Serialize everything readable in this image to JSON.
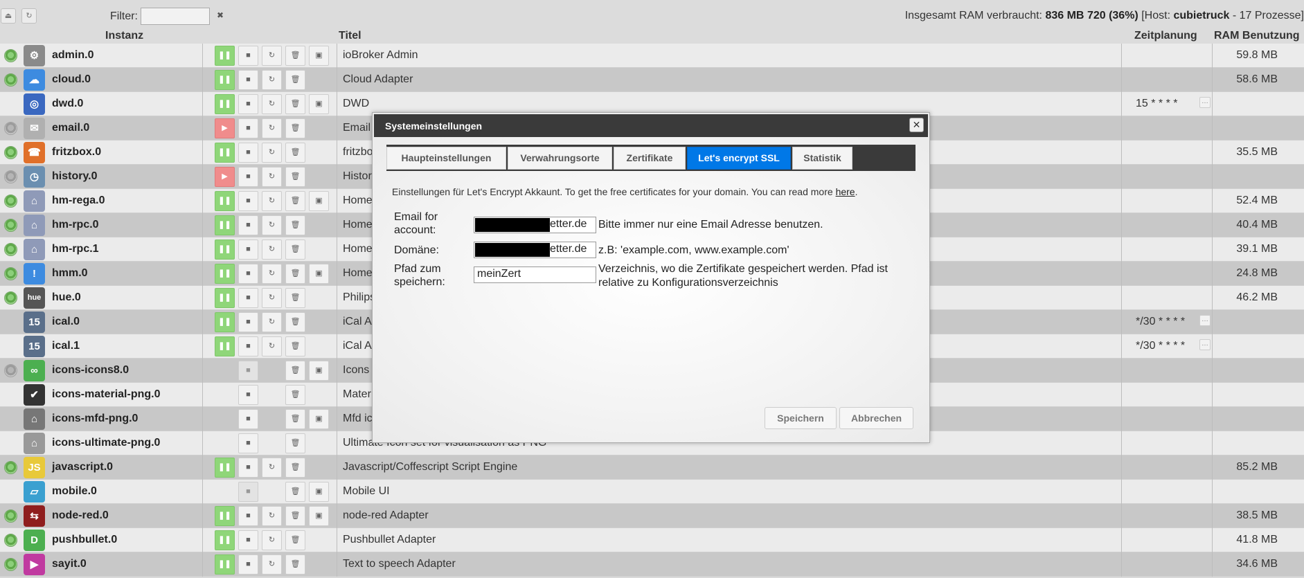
{
  "toolbar": {
    "filter_label": "Filter:",
    "filter_value": "",
    "ram_prefix": "Insgesamt RAM verbraucht:",
    "ram_total": "836",
    "ram_unit": "MB",
    "ram_free": "720 (36%)",
    "host_prefix": "[Host:",
    "host_name": "cubietruck",
    "host_suffix": "- 17 Prozesse]"
  },
  "columns": {
    "instanz": "Instanz",
    "titel": "Titel",
    "zeitplanung": "Zeitplanung",
    "ram": "RAM Benutzung"
  },
  "rows": [
    {
      "name": "admin.0",
      "title": "ioBroker Admin",
      "sched": "",
      "ram": "59.8 MB",
      "status": "on",
      "icon": "gear-icon",
      "glyph": "⚙",
      "color": "#8a8a8a",
      "run": "pause",
      "img": true,
      "restart": true
    },
    {
      "name": "cloud.0",
      "title": "Cloud Adapter",
      "sched": "",
      "ram": "58.6 MB",
      "status": "on",
      "icon": "cloud-icon",
      "glyph": "☁",
      "color": "#3d8be0",
      "run": "pause",
      "img": false,
      "restart": true
    },
    {
      "name": "dwd.0",
      "title": "DWD",
      "sched": "15 * * * *",
      "ram": "",
      "status": "none",
      "icon": "weather-spiral-icon",
      "glyph": "◎",
      "color": "#3a68c0",
      "run": "pause",
      "img": true,
      "restart": true
    },
    {
      "name": "email.0",
      "title": "Email",
      "sched": "",
      "ram": "",
      "status": "off",
      "icon": "envelope-icon",
      "glyph": "✉",
      "color": "#b0b0b0",
      "run": "play",
      "img": false,
      "restart": true
    },
    {
      "name": "fritzbox.0",
      "title": "fritzbox",
      "sched": "",
      "ram": "35.5 MB",
      "status": "on",
      "icon": "phone-icon",
      "glyph": "☎",
      "color": "#e0702a",
      "run": "pause",
      "img": false,
      "restart": true
    },
    {
      "name": "history.0",
      "title": "History",
      "sched": "",
      "ram": "",
      "status": "off",
      "icon": "clock-icon",
      "glyph": "◷",
      "color": "#6b8fb0",
      "run": "play",
      "img": false,
      "restart": true
    },
    {
      "name": "hm-rega.0",
      "title": "Homematic",
      "sched": "",
      "ram": "52.4 MB",
      "status": "on",
      "icon": "homematic-icon",
      "glyph": "⌂",
      "color": "#8f9ab8",
      "run": "pause",
      "img": true,
      "restart": true
    },
    {
      "name": "hm-rpc.0",
      "title": "Homematic",
      "sched": "",
      "ram": "40.4 MB",
      "status": "on",
      "icon": "homematic-icon",
      "glyph": "⌂",
      "color": "#8f9ab8",
      "run": "pause",
      "img": false,
      "restart": true
    },
    {
      "name": "hm-rpc.1",
      "title": "Homematic",
      "sched": "",
      "ram": "39.1 MB",
      "status": "on",
      "icon": "homematic-icon",
      "glyph": "⌂",
      "color": "#8f9ab8",
      "run": "pause",
      "img": false,
      "restart": true
    },
    {
      "name": "hmm.0",
      "title": "Homematic",
      "sched": "",
      "ram": "24.8 MB",
      "status": "on",
      "icon": "exclamation-icon",
      "glyph": "!",
      "color": "#3d8be0",
      "run": "pause",
      "img": true,
      "restart": true
    },
    {
      "name": "hue.0",
      "title": "Philips",
      "sched": "",
      "ram": "46.2 MB",
      "status": "on",
      "icon": "hue-logo-icon",
      "glyph": "hue",
      "color": "#555555",
      "run": "pause",
      "img": false,
      "restart": true
    },
    {
      "name": "ical.0",
      "title": "iCal A",
      "sched": "*/30 * * * *",
      "ram": "",
      "status": "none",
      "icon": "calendar-icon",
      "glyph": "15",
      "color": "#5a6f8a",
      "run": "pause",
      "img": false,
      "restart": true
    },
    {
      "name": "ical.1",
      "title": "iCal A",
      "sched": "*/30 * * * *",
      "ram": "",
      "status": "none",
      "icon": "calendar-icon",
      "glyph": "15",
      "color": "#5a6f8a",
      "run": "pause",
      "img": false,
      "restart": true
    },
    {
      "name": "icons-icons8.0",
      "title": "Icons",
      "sched": "",
      "ram": "",
      "status": "off",
      "icon": "infinity-icon",
      "glyph": "∞",
      "color": "#4caf50",
      "run": "none",
      "img": true,
      "restart": false,
      "stopdim": true
    },
    {
      "name": "icons-material-png.0",
      "title": "Mater",
      "sched": "",
      "ram": "",
      "status": "none",
      "icon": "cloud-check-icon",
      "glyph": "✔",
      "color": "#333333",
      "run": "none",
      "img": false,
      "restart": false
    },
    {
      "name": "icons-mfd-png.0",
      "title": "Mfd ic",
      "sched": "",
      "ram": "",
      "status": "none",
      "icon": "house-icon",
      "glyph": "⌂",
      "color": "#777777",
      "run": "none",
      "img": true,
      "restart": false
    },
    {
      "name": "icons-ultimate-png.0",
      "title": "Ultimate Icon set for visualisation as PNG",
      "sched": "",
      "ram": "",
      "status": "none",
      "icon": "house-icon",
      "glyph": "⌂",
      "color": "#999999",
      "run": "none",
      "img": false,
      "restart": false
    },
    {
      "name": "javascript.0",
      "title": "Javascript/Coffescript Script Engine",
      "sched": "",
      "ram": "85.2 MB",
      "status": "on",
      "icon": "js-icon",
      "glyph": "JS",
      "color": "#e8c93a",
      "run": "pause",
      "img": false,
      "restart": true
    },
    {
      "name": "mobile.0",
      "title": "Mobile UI",
      "sched": "",
      "ram": "",
      "status": "none",
      "icon": "mobile-icon",
      "glyph": "▱",
      "color": "#3aa0d0",
      "run": "none",
      "img": true,
      "restart": false,
      "stopdim": true
    },
    {
      "name": "node-red.0",
      "title": "node-red Adapter",
      "sched": "",
      "ram": "38.5 MB",
      "status": "on",
      "icon": "node-red-icon",
      "glyph": "⇆",
      "color": "#8f1e1e",
      "run": "pause",
      "img": true,
      "restart": true
    },
    {
      "name": "pushbullet.0",
      "title": "Pushbullet Adapter",
      "sched": "",
      "ram": "41.8 MB",
      "status": "on",
      "icon": "pushbullet-icon",
      "glyph": "D",
      "color": "#4caf50",
      "run": "pause",
      "img": false,
      "restart": true
    },
    {
      "name": "sayit.0",
      "title": "Text to speech Adapter",
      "sched": "",
      "ram": "34.6 MB",
      "status": "on",
      "icon": "sayit-icon",
      "glyph": "▶",
      "color": "#c03aa0",
      "run": "pause",
      "img": false,
      "restart": true
    }
  ],
  "dialog": {
    "title": "Systemeinstellungen",
    "tabs": [
      "Haupteinstellungen",
      "Verwahrungsorte",
      "Zertifikate",
      "Let's encrypt SSL",
      "Statistik"
    ],
    "active_tab": "Let's encrypt SSL",
    "intro_text": "Einstellungen für Let's Encrypt Akkaunt. To get the free certificates for your domain. You can read more ",
    "intro_link": "here",
    "intro_end": ".",
    "email_label": "Email for account:",
    "email_value": "etter.de",
    "email_hint": "Bitte immer nur eine Email Adresse benutzen.",
    "domain_label": "Domäne:",
    "domain_value": "etter.de",
    "domain_hint": "z.B: 'example.com, www.example.com'",
    "path_label": "Pfad zum speichern:",
    "path_value": "meinZert",
    "path_hint": "Verzeichnis, wo die Zertifikate gespeichert werden. Pfad ist relative zu Konfigurationsverzeichnis",
    "save_label": "Speichern",
    "cancel_label": "Abbrechen"
  }
}
